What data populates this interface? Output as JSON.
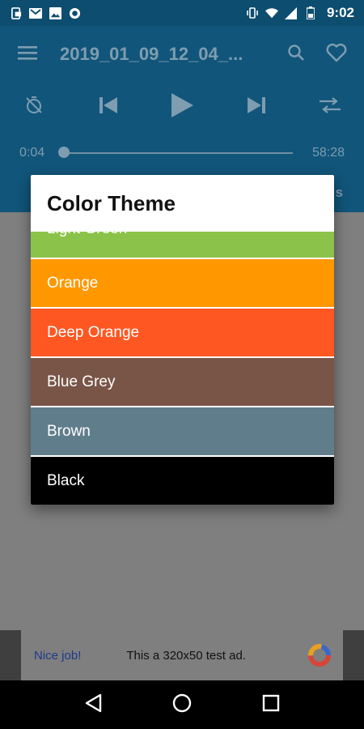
{
  "status_bar": {
    "time": "9:02",
    "left_icons": [
      "app-notification-icon",
      "gmail-icon",
      "image-icon",
      "circle-icon"
    ],
    "right_icons": [
      "vibrate-icon",
      "wifi-icon",
      "mobile-signal-icon",
      "battery-icon"
    ]
  },
  "toolbar": {
    "title": "2019_01_09_12_04_...",
    "icons": [
      "menu-icon",
      "search-icon",
      "heart-icon"
    ]
  },
  "player": {
    "icons": [
      "timer-off-icon",
      "skip-previous-icon",
      "play-icon",
      "skip-next-icon",
      "shuffle-icon"
    ],
    "current_time": "0:04",
    "total_time": "58:28",
    "progress": 0.0
  },
  "dialog": {
    "title": "Color Theme",
    "options": [
      {
        "label": "Light Green",
        "color": "#8bc34a"
      },
      {
        "label": "Orange",
        "color": "#ff9800"
      },
      {
        "label": "Deep Orange",
        "color": "#ff5722"
      },
      {
        "label": "Blue Grey",
        "color": "#795548"
      },
      {
        "label": "Brown",
        "color": "#607d8b"
      },
      {
        "label": "Black",
        "color": "#000000"
      }
    ]
  },
  "ad": {
    "nice_label": "Nice job!",
    "text": "This a 320x50 test ad."
  },
  "nav": {
    "icons": [
      "back-icon",
      "home-icon",
      "recents-icon"
    ]
  }
}
